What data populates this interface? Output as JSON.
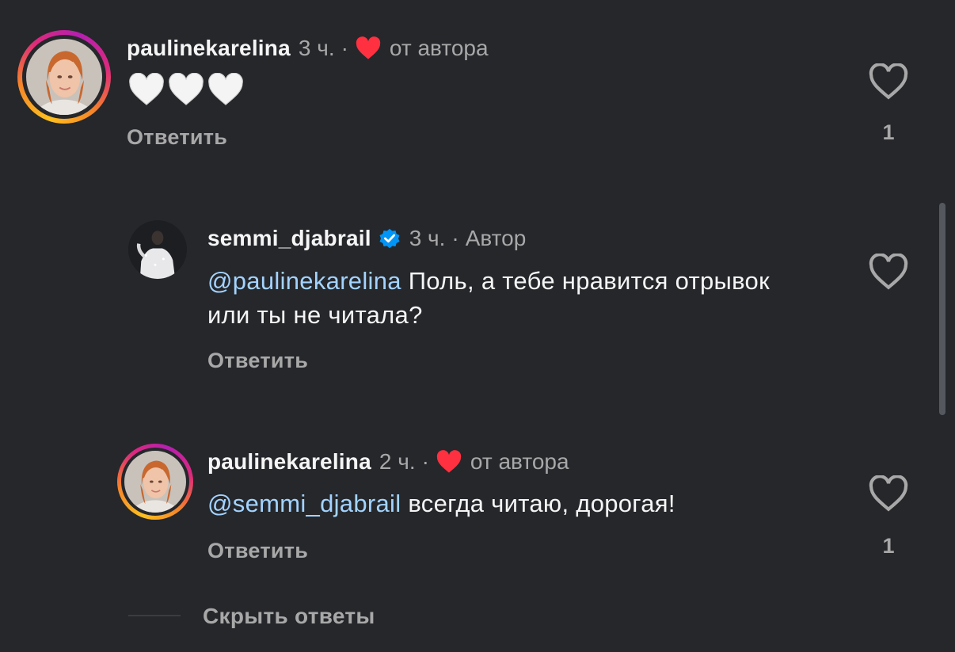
{
  "comments": [
    {
      "username": "paulinekarelina",
      "time": "3 ч.",
      "separator": "·",
      "author_like_label": "от автора",
      "text_emoji": [
        "🤍",
        "🤍",
        "🤍"
      ],
      "reply_label": "Ответить",
      "like_count": "1"
    },
    {
      "username": "semmi_djabrail",
      "time": "3 ч.",
      "separator": "·",
      "author_badge": "Автор",
      "mention": "@paulinekarelina",
      "text": " Поль, а тебе нравится отрывок или ты не читала?",
      "reply_label": "Ответить",
      "like_count": ""
    },
    {
      "username": "paulinekarelina",
      "time": "2 ч.",
      "separator": "·",
      "author_like_label": "от автора",
      "mention": "@semmi_djabrail",
      "text": " всегда читаю, дорогая!",
      "reply_label": "Ответить",
      "like_count": "1"
    }
  ],
  "hide_replies_label": "Скрыть ответы",
  "colors": {
    "background": "#25272b",
    "mention": "#a3d3ff",
    "heart_red": "#ff3040",
    "verified_blue": "#0095f6",
    "muted": "#a8a8a8"
  },
  "icons": {
    "like": "heart-outline-icon",
    "author_like": "heart-filled-icon",
    "verified": "verified-badge-icon"
  }
}
